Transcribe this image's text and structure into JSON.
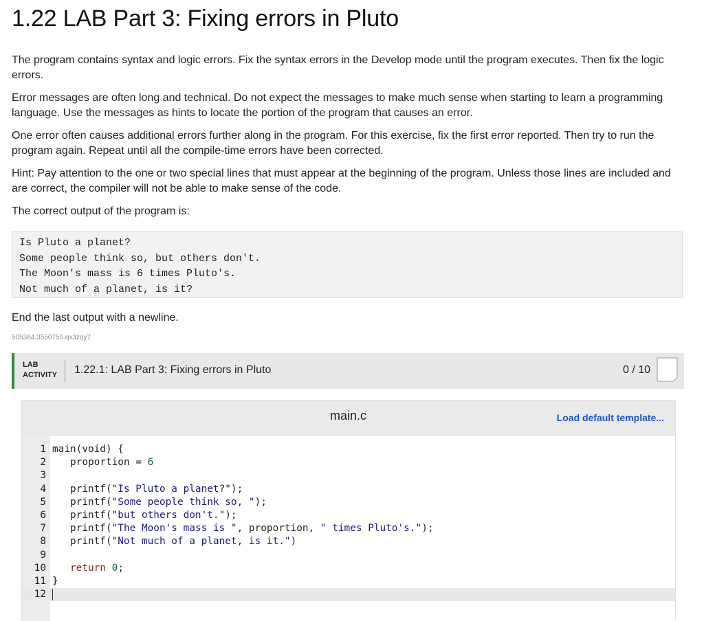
{
  "page": {
    "title": "1.22 LAB Part 3: Fixing errors in Pluto",
    "paragraphs": [
      "The program contains syntax and logic errors. Fix the syntax errors in the Develop mode until the program executes. Then fix the logic errors.",
      "Error messages are often long and technical. Do not expect the messages to make much sense when starting to learn a programming language. Use the messages as hints to locate the portion of the program that causes an error.",
      "One error often causes additional errors further along in the program. For this exercise, fix the first error reported. Then try to run the program again. Repeat until all the compile-time errors have been corrected.",
      "Hint: Pay attention to the one or two special lines that must appear at the beginning of the program. Unless those lines are included and are correct, the compiler will not be able to make sense of the code.",
      "The correct output of the program is:"
    ],
    "expected_output": [
      "Is Pluto a planet?",
      "Some people think so, but others don't.",
      "The Moon's mass is 6 times Pluto's.",
      "Not much of a planet, is it?"
    ],
    "after_output": "End the last output with a newline.",
    "reference_id": "505384.3550750.qx3zqy7"
  },
  "lab": {
    "tag_line1": "LAB",
    "tag_line2": "ACTIVITY",
    "title": "1.22.1: LAB Part 3: Fixing errors in Pluto",
    "score": "0 / 10",
    "accent_color": "#2e8b3a"
  },
  "editor": {
    "file_name": "main.c",
    "load_template_label": "Load default template...",
    "active_line": 12,
    "lines": [
      {
        "n": "1",
        "text": "main(void) {"
      },
      {
        "n": "2",
        "text": "   proportion = 6"
      },
      {
        "n": "3",
        "text": ""
      },
      {
        "n": "4",
        "text": "   printf(\"Is Pluto a planet?\");"
      },
      {
        "n": "5",
        "text": "   printf(\"Some people think so, \");"
      },
      {
        "n": "6",
        "text": "   printf(\"but others don't.\");"
      },
      {
        "n": "7",
        "text": "   printf(\"The Moon's mass is \", proportion, \" times Pluto's.\");"
      },
      {
        "n": "8",
        "text": "   printf(\"Not much of a planet, is it.\")"
      },
      {
        "n": "9",
        "text": ""
      },
      {
        "n": "10",
        "text": "   return 0;"
      },
      {
        "n": "11",
        "text": "}"
      },
      {
        "n": "12",
        "text": ""
      }
    ]
  }
}
